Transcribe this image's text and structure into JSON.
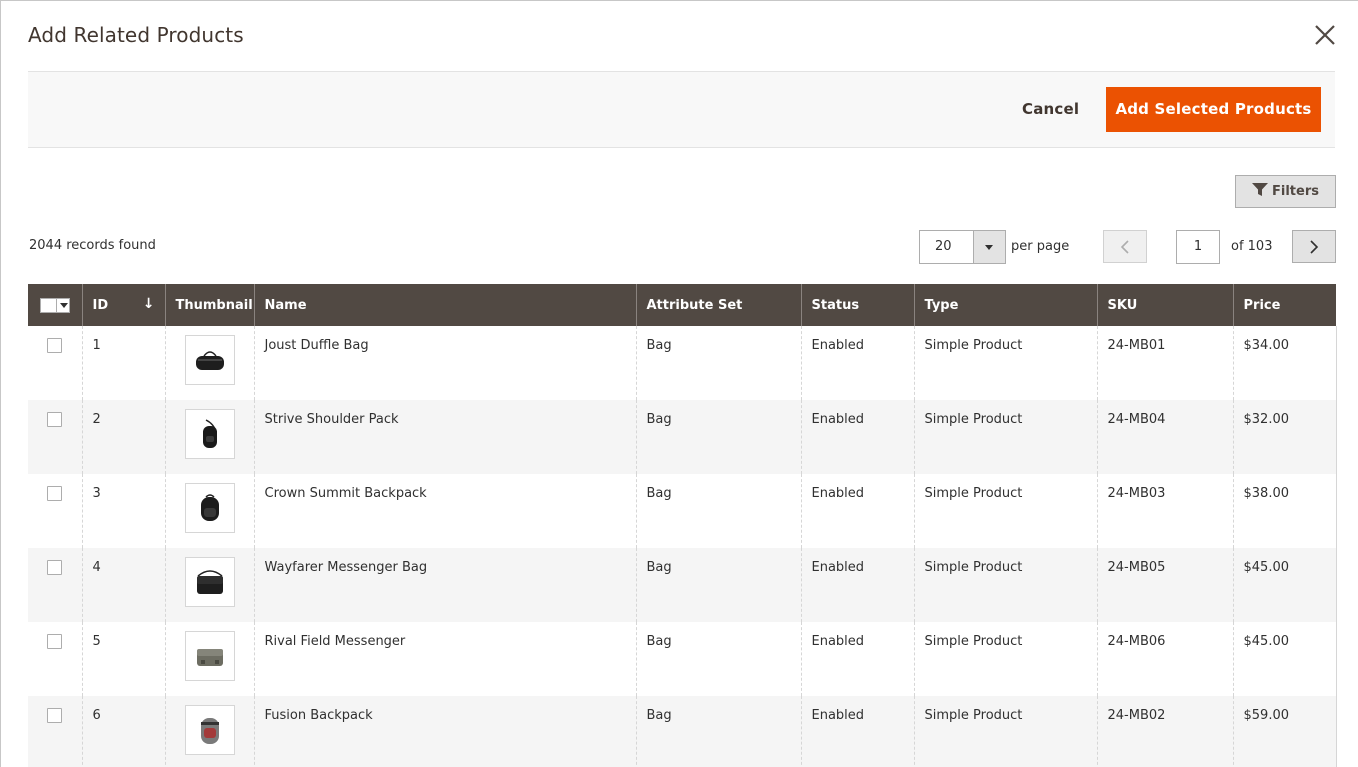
{
  "modal": {
    "title": "Add Related Products",
    "close_icon": "close-icon"
  },
  "actions": {
    "cancel_label": "Cancel",
    "add_label": "Add Selected Products"
  },
  "toolbar": {
    "filters_label": "Filters",
    "filters_icon": "funnel-icon",
    "records_found": "2044 records found",
    "per_page_value": "20",
    "per_page_label": "per page",
    "current_page": "1",
    "page_total": "of 103"
  },
  "colors": {
    "accent": "#eb5202",
    "header_bg": "#514943"
  },
  "table": {
    "columns": [
      "ID",
      "Thumbnail",
      "Name",
      "Attribute Set",
      "Status",
      "Type",
      "SKU",
      "Price"
    ],
    "rows": [
      {
        "id": "1",
        "name": "Joust Duffle Bag",
        "attribute_set": "Bag",
        "status": "Enabled",
        "type": "Simple Product",
        "sku": "24-MB01",
        "price": "$34.00",
        "thumbnail": "duffle-bag-image"
      },
      {
        "id": "2",
        "name": "Strive Shoulder Pack",
        "attribute_set": "Bag",
        "status": "Enabled",
        "type": "Simple Product",
        "sku": "24-MB04",
        "price": "$32.00",
        "thumbnail": "shoulder-pack-image"
      },
      {
        "id": "3",
        "name": "Crown Summit Backpack",
        "attribute_set": "Bag",
        "status": "Enabled",
        "type": "Simple Product",
        "sku": "24-MB03",
        "price": "$38.00",
        "thumbnail": "backpack-image"
      },
      {
        "id": "4",
        "name": "Wayfarer Messenger Bag",
        "attribute_set": "Bag",
        "status": "Enabled",
        "type": "Simple Product",
        "sku": "24-MB05",
        "price": "$45.00",
        "thumbnail": "messenger-bag-image"
      },
      {
        "id": "5",
        "name": "Rival Field Messenger",
        "attribute_set": "Bag",
        "status": "Enabled",
        "type": "Simple Product",
        "sku": "24-MB06",
        "price": "$45.00",
        "thumbnail": "field-messenger-image"
      },
      {
        "id": "6",
        "name": "Fusion Backpack",
        "attribute_set": "Bag",
        "status": "Enabled",
        "type": "Simple Product",
        "sku": "24-MB02",
        "price": "$59.00",
        "thumbnail": "fusion-backpack-image"
      }
    ]
  }
}
